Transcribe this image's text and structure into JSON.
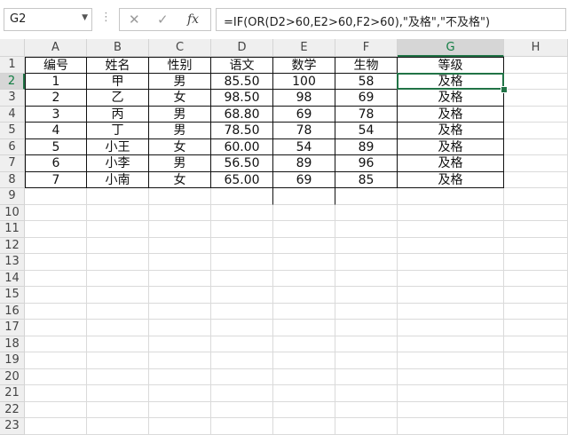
{
  "formula_bar": {
    "name_box": "G2",
    "name_box_dropdown_icon": "chevron-down-icon",
    "more_icon": "vertical-dots-icon",
    "cancel_icon": "close-icon",
    "enter_icon": "check-icon",
    "fx_label": "fx",
    "formula": "=IF(OR(D2>60,E2>60,F2>60),\"及格\",\"不及格\")"
  },
  "columns": [
    "A",
    "B",
    "C",
    "D",
    "E",
    "F",
    "G",
    "H"
  ],
  "rows": [
    "1",
    "2",
    "3",
    "4",
    "5",
    "6",
    "7",
    "8",
    "9",
    "10",
    "11",
    "12",
    "13",
    "14",
    "15",
    "16",
    "17",
    "18",
    "19",
    "20",
    "21",
    "22",
    "23"
  ],
  "selected_cell": "G2",
  "table": {
    "headers": [
      "编号",
      "姓名",
      "性别",
      "语文",
      "数学",
      "生物",
      "等级"
    ],
    "data": [
      [
        "1",
        "甲",
        "男",
        "85.50",
        "100",
        "58",
        "及格"
      ],
      [
        "2",
        "乙",
        "女",
        "98.50",
        "98",
        "69",
        "及格"
      ],
      [
        "3",
        "丙",
        "男",
        "68.80",
        "69",
        "78",
        "及格"
      ],
      [
        "4",
        "丁",
        "男",
        "78.50",
        "78",
        "54",
        "及格"
      ],
      [
        "5",
        "小王",
        "女",
        "60.00",
        "54",
        "89",
        "及格"
      ],
      [
        "6",
        "小李",
        "男",
        "56.50",
        "89",
        "96",
        "及格"
      ],
      [
        "7",
        "小南",
        "女",
        "65.00",
        "69",
        "85",
        "及格"
      ]
    ]
  },
  "colors": {
    "accent": "#217346",
    "header_bg": "#efefef",
    "selected_header_bg": "#d6d6d6"
  }
}
